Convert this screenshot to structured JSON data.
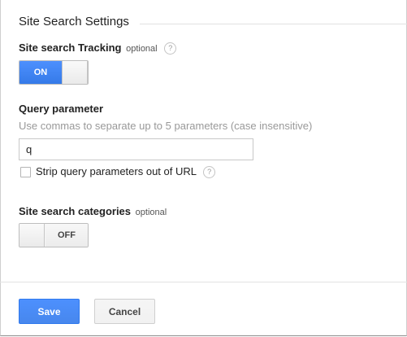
{
  "section": {
    "title": "Site Search Settings"
  },
  "tracking": {
    "label": "Site search Tracking",
    "optional": "optional",
    "help": "?",
    "toggle_state": "ON"
  },
  "query": {
    "label": "Query parameter",
    "hint": "Use commas to separate up to 5 parameters (case insensitive)",
    "value": "q",
    "strip_label": "Strip query parameters out of URL",
    "strip_checked": false,
    "help": "?"
  },
  "categories": {
    "label": "Site search categories",
    "optional": "optional",
    "toggle_state": "OFF"
  },
  "buttons": {
    "save": "Save",
    "cancel": "Cancel"
  },
  "colors": {
    "accent": "#4d90fe",
    "hint": "#999999"
  }
}
